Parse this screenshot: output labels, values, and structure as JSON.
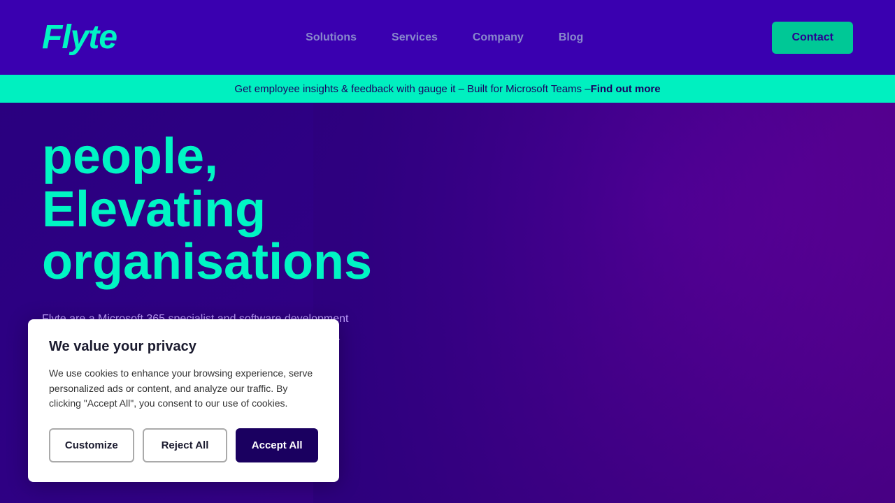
{
  "nav": {
    "logo": "Flyte",
    "links": [
      {
        "label": "Solutions",
        "name": "solutions"
      },
      {
        "label": "Services",
        "name": "services"
      },
      {
        "label": "Company",
        "name": "company"
      },
      {
        "label": "Blog",
        "name": "blog"
      }
    ],
    "contact_label": "Contact"
  },
  "announcement": {
    "text": "Get employee insights & feedback with gauge it – Built for Microsoft Teams – ",
    "link_text": "Find out more"
  },
  "hero": {
    "heading_line1": "people,",
    "heading_line2": "Elevating",
    "heading_line3": "organisations",
    "subtext": "Flyte are a Microsoft 365 specialist and software development company focused on delivering cloud-based solutions with a breadth of"
  },
  "cookie": {
    "title": "We value your privacy",
    "body": "We use cookies to enhance your browsing experience, serve personalized ads or content, and analyze our traffic. By clicking \"Accept All\", you consent to our use of cookies.",
    "customize_label": "Customize",
    "reject_label": "Reject All",
    "accept_label": "Accept All"
  }
}
